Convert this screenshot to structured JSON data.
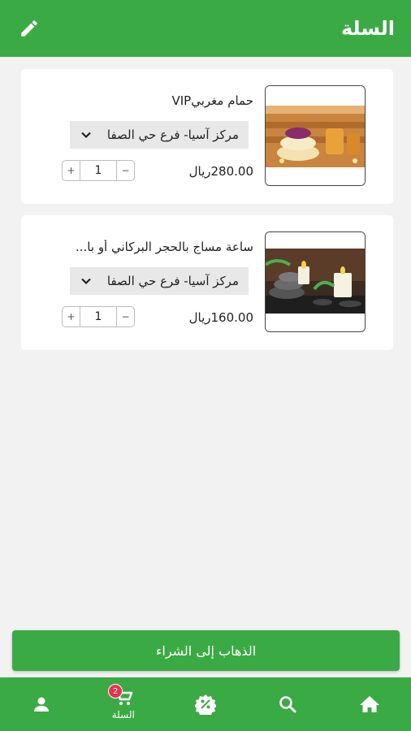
{
  "header": {
    "title": "السلة"
  },
  "cart": {
    "items": [
      {
        "name": "حمام مغربيVIP",
        "branch": "مركز آسيا- فرع حي الصفا",
        "price": "280.00ريال",
        "quantity": "1"
      },
      {
        "name": "ساعة مساج بالحجر البركاني أو با...",
        "branch": "مركز آسيا- فرع حي الصفا",
        "price": "160.00ريال",
        "quantity": "1"
      }
    ]
  },
  "checkout": {
    "label": "الذهاب إلى الشراء"
  },
  "nav": {
    "cart_label": "السلة",
    "cart_badge": "2"
  },
  "colors": {
    "primary": "#3aaa45",
    "badge": "#e8314f",
    "background": "#f2f2f2"
  }
}
